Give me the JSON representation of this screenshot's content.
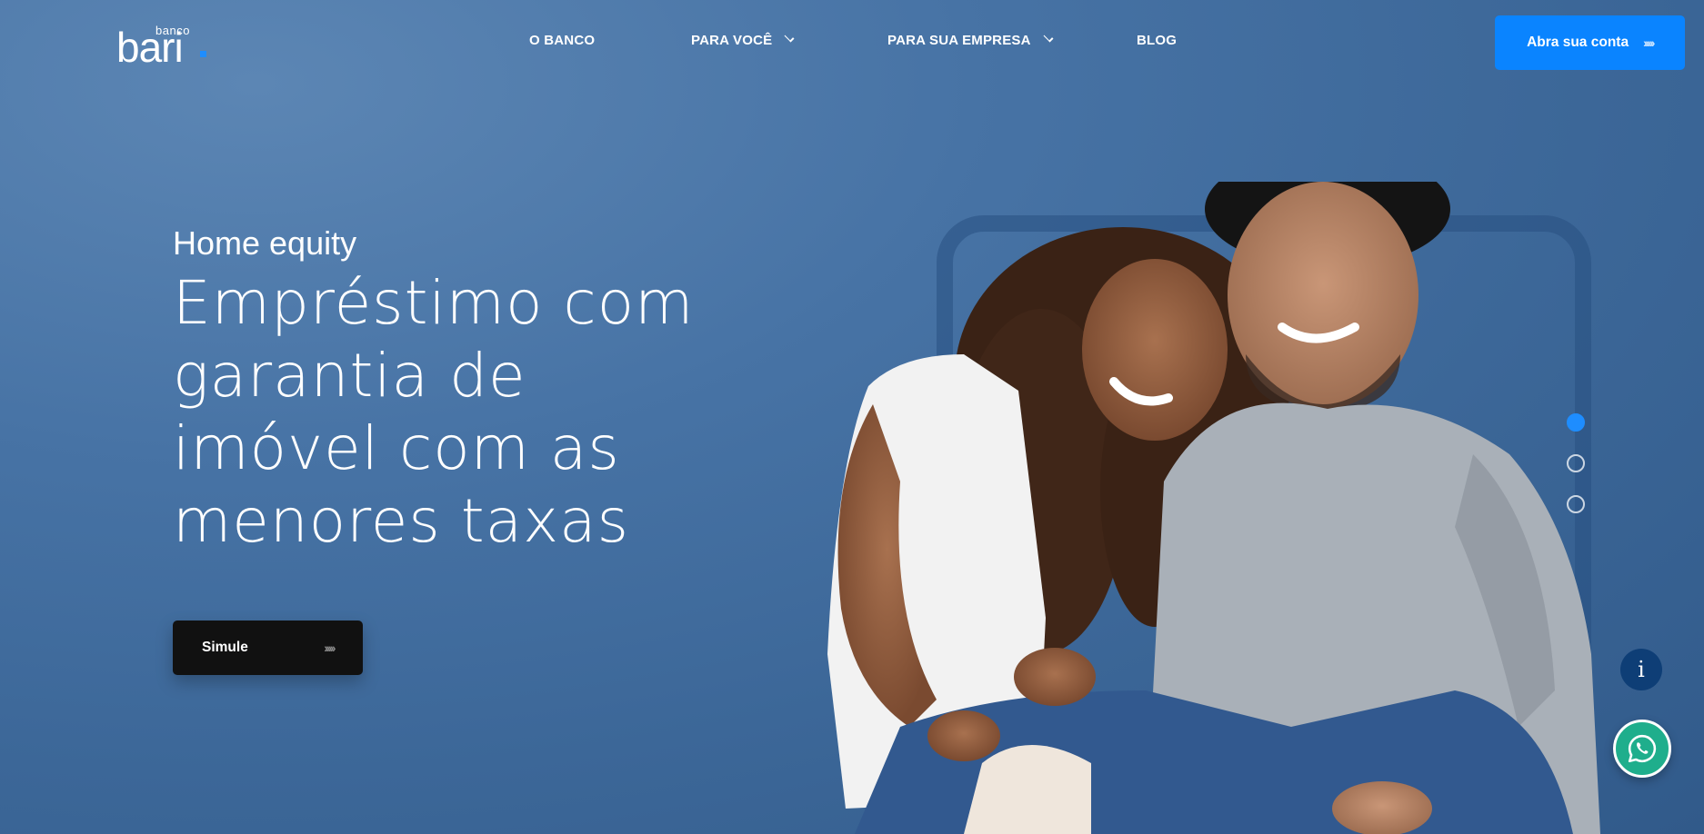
{
  "brand": {
    "logo_small": "banco",
    "logo_main": "bari"
  },
  "nav": {
    "items": [
      {
        "label": "O BANCO"
      },
      {
        "label": "PARA VOCÊ"
      },
      {
        "label": "PARA SUA EMPRESA"
      },
      {
        "label": "BLOG"
      }
    ],
    "cta_label": "Abra sua conta"
  },
  "hero": {
    "eyebrow": "Home equity",
    "headline_lines": [
      "Empréstimo com",
      "garantia de",
      "imóvel com as",
      "menores taxas"
    ],
    "button_label": "Simule",
    "chevrons": "›››››"
  },
  "carousel": {
    "slide_count": 3,
    "active_slide": 1
  },
  "floating": {
    "info_symbol": "i",
    "whatsapp_icon": "whatsapp-icon"
  },
  "colors": {
    "accent": "#0a84ff",
    "background": "#4773a5",
    "button_dark": "#111111",
    "whatsapp": "#1fae8c"
  }
}
